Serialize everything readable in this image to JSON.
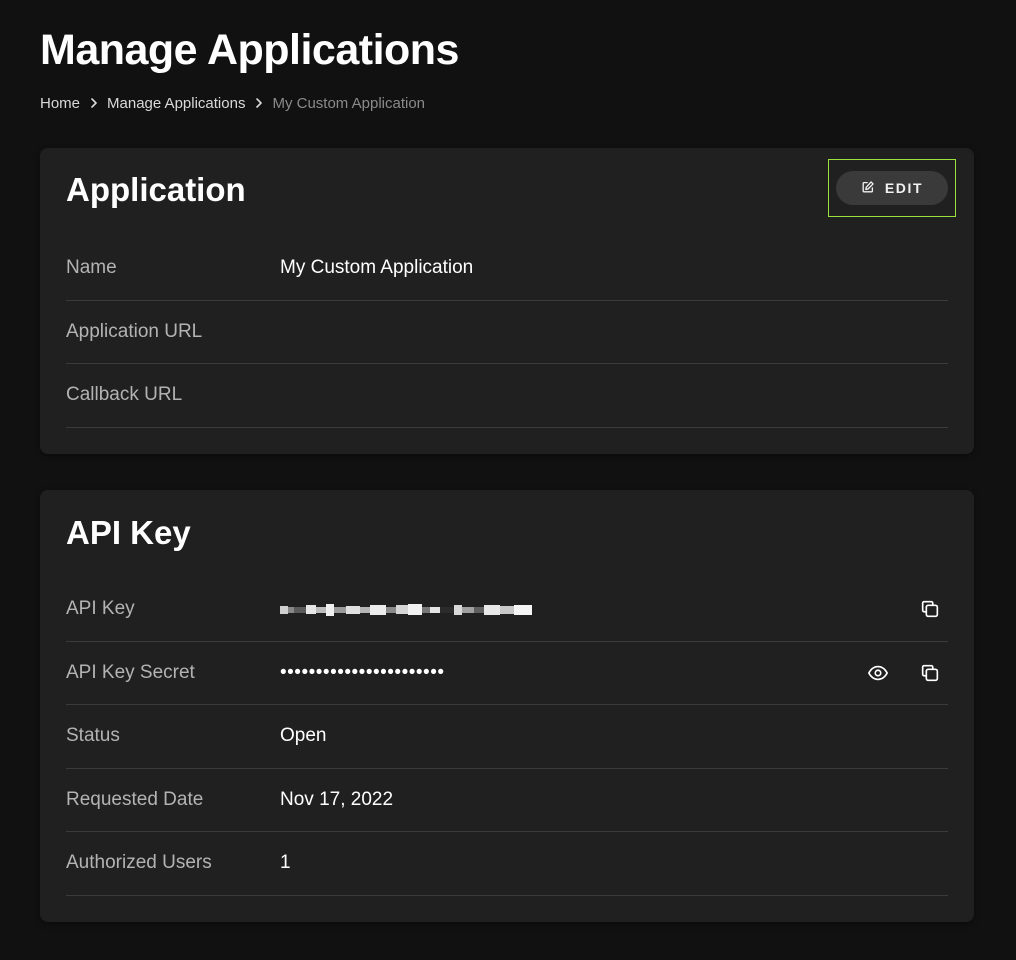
{
  "page": {
    "title": "Manage Applications"
  },
  "breadcrumb": {
    "items": [
      "Home",
      "Manage Applications"
    ],
    "current": "My Custom Application"
  },
  "application_card": {
    "title": "Application",
    "edit_label": "EDIT",
    "rows": [
      {
        "label": "Name",
        "value": "My Custom Application"
      },
      {
        "label": "Application URL",
        "value": ""
      },
      {
        "label": "Callback URL",
        "value": ""
      }
    ]
  },
  "api_card": {
    "title": "API Key",
    "rows": [
      {
        "label": "API Key",
        "value": "",
        "redacted": true
      },
      {
        "label": "API Key Secret",
        "value": "•••••••••••••••••••••••"
      },
      {
        "label": "Status",
        "value": "Open"
      },
      {
        "label": "Requested Date",
        "value": "Nov 17, 2022"
      },
      {
        "label": "Authorized Users",
        "value": "1"
      }
    ]
  },
  "icons": {
    "breadcrumb_separator": "chevron-right-icon",
    "edit": "pencil-square-icon",
    "copy": "copy-icon",
    "reveal": "eye-icon"
  },
  "colors": {
    "background": "#111111",
    "card": "#202020",
    "focus_outline": "#9be03c"
  }
}
